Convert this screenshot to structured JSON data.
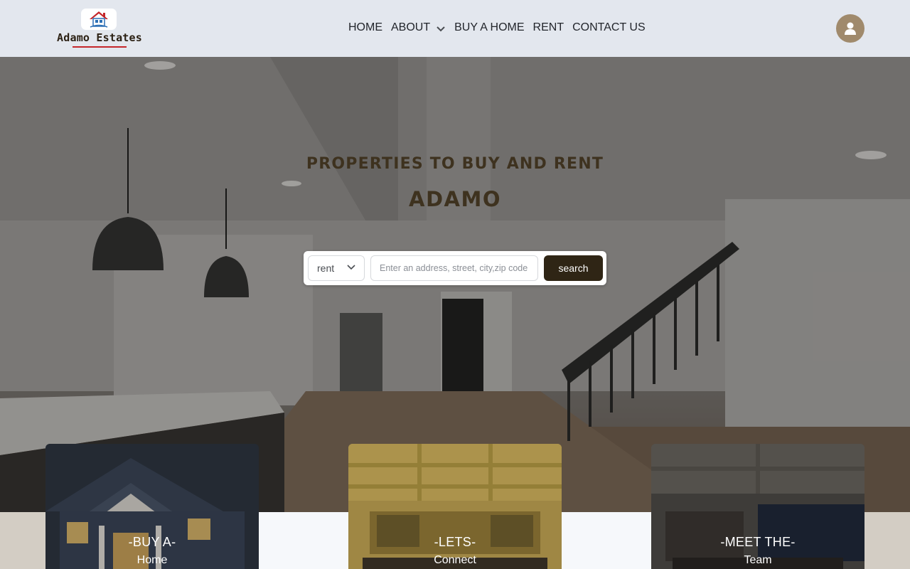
{
  "header": {
    "logo_text": "Adamo Estates",
    "nav": [
      {
        "label": "HOME"
      },
      {
        "label": "ABOUT",
        "has_dropdown": true
      },
      {
        "label": "BUY A HOME"
      },
      {
        "label": "RENT"
      },
      {
        "label": "CONTACT US"
      }
    ],
    "avatar_icon": "user-icon"
  },
  "hero": {
    "subtitle": "PROPERTIES TO BUY AND RENT",
    "title": "ADAMO"
  },
  "search": {
    "type_value": "rent",
    "input_placeholder": "Enter an address, street, city,zip code",
    "button_label": "search"
  },
  "cards": [
    {
      "label": "-BUY A-",
      "sub": "Home"
    },
    {
      "label": "-LETS-",
      "sub": "Connect"
    },
    {
      "label": "-MEET THE-",
      "sub": "Team"
    }
  ],
  "colors": {
    "header_bg": "#e3e7ee",
    "accent_dark": "#2f2515",
    "logo_underline": "#c4262a",
    "avatar_bg": "#a08a6c"
  }
}
